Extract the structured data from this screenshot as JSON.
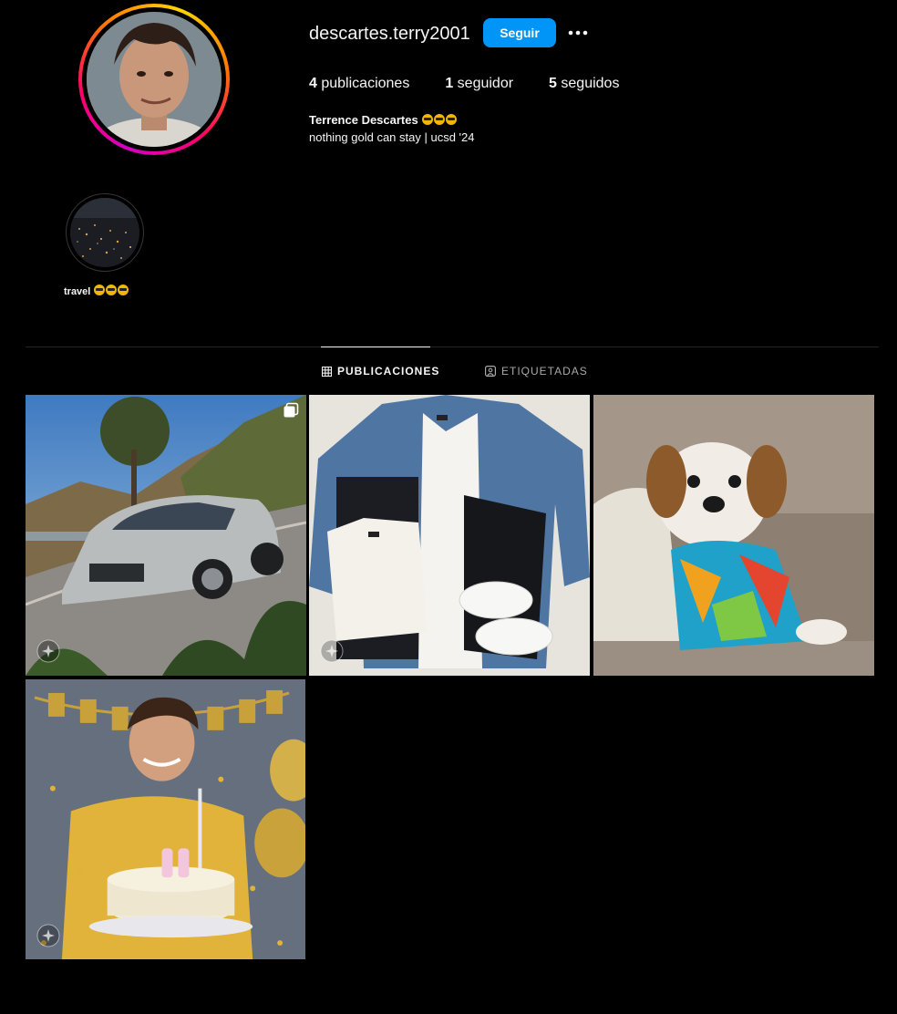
{
  "profile": {
    "username": "descartes.terry2001",
    "follow_label": "Seguir",
    "more_options_icon": "more-horizontal-icon",
    "stats": {
      "posts_count": "4",
      "posts_label": "publicaciones",
      "followers_count": "1",
      "followers_label": "seguidor",
      "following_count": "5",
      "following_label": "seguidos"
    },
    "full_name": "Terrence Descartes",
    "name_emoji": "nerd-face-emoji x3",
    "bio": "nothing gold can stay | ucsd '24"
  },
  "highlights": [
    {
      "label": "travel",
      "emoji": "smiling-face-with-sunglasses x3"
    }
  ],
  "tabs": [
    {
      "label": "PUBLICACIONES",
      "icon": "grid-icon",
      "active": true
    },
    {
      "label": "ETIQUETADAS",
      "icon": "tagged-user-icon",
      "active": false
    }
  ],
  "posts": [
    {
      "subject": "silver sedan on coastal mountain road",
      "multi": true,
      "ai_label": true
    },
    {
      "subject": "flat lay of denim jacket, white shirt, jeans and sneakers",
      "multi": false,
      "ai_label": true
    },
    {
      "subject": "small dog in colorful hawaiian shirt",
      "multi": false,
      "ai_label": false
    },
    {
      "subject": "young man celebrating birthday with 23 cake",
      "multi": false,
      "ai_label": true
    }
  ],
  "colors": {
    "background": "#000000",
    "primary_button": "#0095f6",
    "text_primary": "#f5f5f5",
    "text_secondary": "#a8a8a8",
    "divider": "#262626"
  }
}
